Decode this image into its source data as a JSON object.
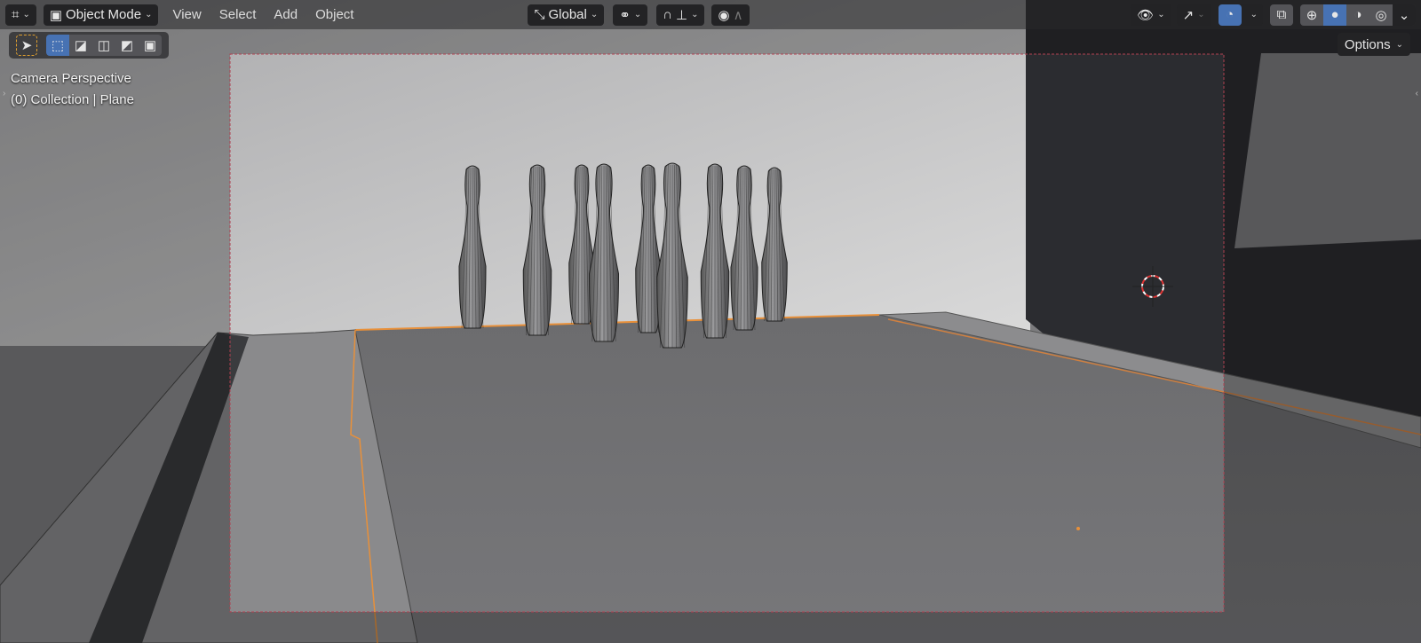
{
  "header": {
    "editor_type_icon": "viewport-icon",
    "mode": "Object Mode",
    "menus": [
      "View",
      "Select",
      "Add",
      "Object"
    ],
    "transform_orientation": "Global",
    "shading_modes": [
      "wireframe",
      "solid",
      "material",
      "rendered"
    ],
    "active_shading": "solid"
  },
  "toolbar": {
    "select_modes": [
      "new",
      "extend",
      "subtract",
      "invert",
      "intersect"
    ],
    "active_select_mode": "new"
  },
  "overlay": {
    "view_name": "Camera Perspective",
    "collection_info": "(0) Collection | Plane"
  },
  "options_label": "Options",
  "colors": {
    "accent": "#4772b3",
    "selection_outline": "#e8903a",
    "camera_frame": "#b04050"
  }
}
